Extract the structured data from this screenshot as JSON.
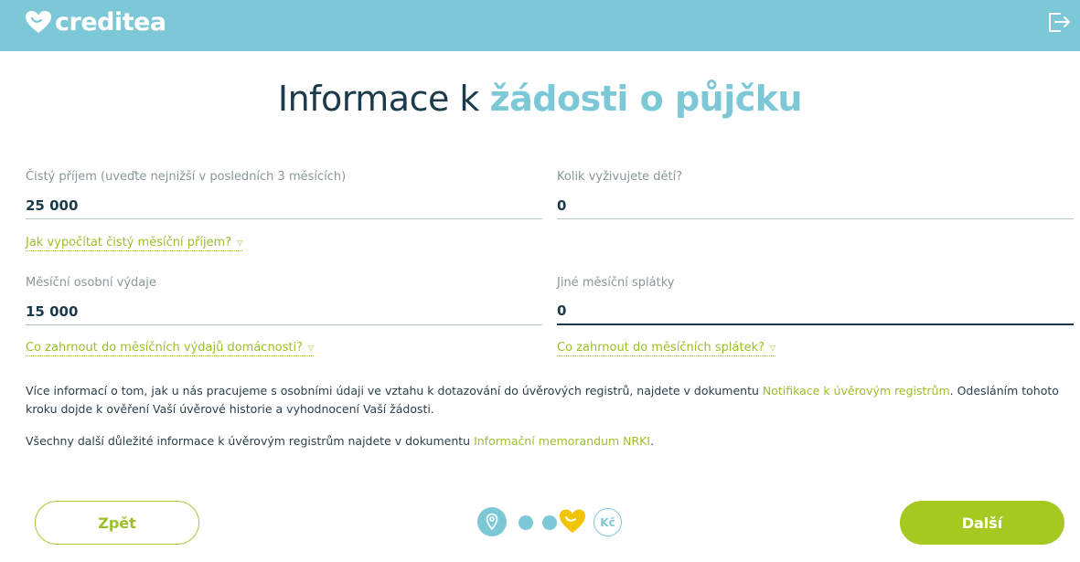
{
  "header": {
    "logo_text": "creditea",
    "logout_icon": "logout-icon",
    "bg_color": "#7dc8d6"
  },
  "page": {
    "title_plain": "Informace k ",
    "title_accent": "žádosti o půjčku"
  },
  "form": {
    "net_income": {
      "label": "Čistý příjem (uveďte nejnižší v posledních 3 měsících)",
      "value": "25 000",
      "help": "Jak vypočítat čistý měsíční příjem?"
    },
    "children": {
      "label": "Kolik vyživujete dětí?",
      "value": "0"
    },
    "expenses": {
      "label": "Měsíční osobní výdaje",
      "value": "15 000",
      "help": "Co zahrnout do měsíčních výdajů domácnosti?"
    },
    "other_payments": {
      "label": "Jiné měsíční splátky",
      "value": "0",
      "help": "Co zahrnout do měsíčních splátek?"
    }
  },
  "info": {
    "p1_before": "Více informací o tom, jak u nás pracujeme s osobními údaji ve vztahu k dotazování do úvěrových registrů, najdete v dokumentu ",
    "p1_link": "Notifikace k úvěrovým registrům",
    "p1_after": ". Odesláním tohoto kroku dojde k ověření Vaší úvěrové historie a vyhodnocení Vaší žádosti.",
    "p2_before": "Všechny další důležité informace k úvěrovým registrům najdete v dokumentu ",
    "p2_link": "Informační memorandum NRKI",
    "p2_after": "."
  },
  "nav": {
    "back_label": "Zpět",
    "next_label": "Další",
    "steps": [
      "location-pin-icon",
      "step-dot",
      "step-dot",
      "heart-icon",
      "Kč"
    ]
  },
  "colors": {
    "accent_blue": "#7dc8d6",
    "accent_green": "#a5c920",
    "heart_yellow": "#f2c400",
    "text_dark": "#1b3a4b"
  }
}
